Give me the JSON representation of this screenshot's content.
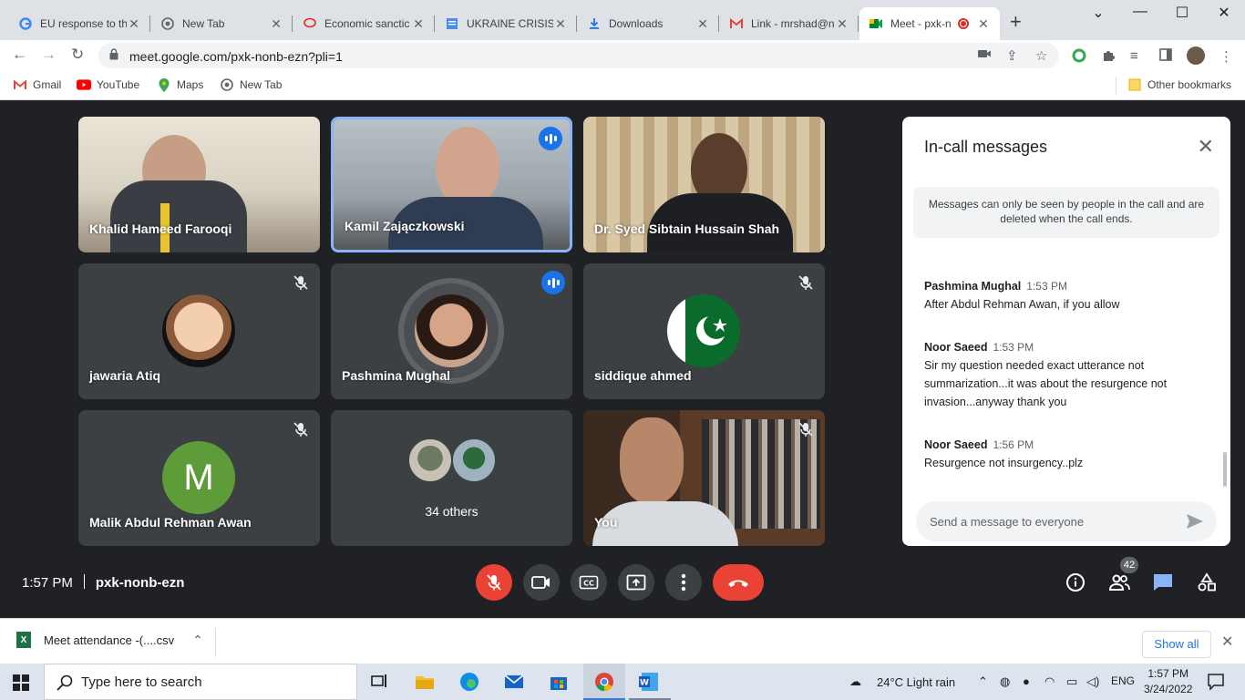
{
  "tabs": [
    {
      "title": "EU response to th",
      "icon": "google-icon"
    },
    {
      "title": "New Tab",
      "icon": "chrome-icon"
    },
    {
      "title": "Economic sanctic",
      "icon": "chat-bubble-icon"
    },
    {
      "title": "UKRAINE CRISIS",
      "icon": "doc-icon"
    },
    {
      "title": "Downloads",
      "icon": "download-icon"
    },
    {
      "title": "Link - mrshad@n",
      "icon": "gmail-icon"
    },
    {
      "title": "Meet - pxk-n",
      "icon": "meet-icon"
    }
  ],
  "address": {
    "url": "meet.google.com/pxk-nonb-ezn?pli=1"
  },
  "bookmarks": [
    {
      "label": "Gmail"
    },
    {
      "label": "YouTube"
    },
    {
      "label": "Maps"
    },
    {
      "label": "New Tab"
    }
  ],
  "other_bookmarks": "Other bookmarks",
  "participants": [
    {
      "name": "Khalid Hameed Farooqi"
    },
    {
      "name": "Kamil Zajączkowski"
    },
    {
      "name": "Dr. Syed Sibtain Hussain Shah"
    },
    {
      "name": "jawaria Atiq"
    },
    {
      "name": "Pashmina Mughal"
    },
    {
      "name": "siddique ahmed"
    },
    {
      "name": "Malik Abdul Rehman Awan",
      "initial": "M"
    },
    {
      "name": "34 others"
    },
    {
      "name": "You"
    }
  ],
  "chat": {
    "title": "In-call messages",
    "notice": "Messages can only be seen by people in the call and are deleted when the call ends.",
    "messages": [
      {
        "sender": "Pashmina Mughal",
        "time": "1:53 PM",
        "text": "After Abdul Rehman Awan, if you allow"
      },
      {
        "sender": "Noor Saeed",
        "time": "1:53 PM",
        "text": "Sir my question needed exact utterance not summarization...it was about the resurgence not invasion...anyway thank you"
      },
      {
        "sender": "Noor Saeed",
        "time": "1:56 PM",
        "text": "Resurgence not insurgency..plz"
      }
    ],
    "input_placeholder": "Send a message to everyone"
  },
  "controls": {
    "time": "1:57 PM",
    "meeting_code": "pxk-nonb-ezn",
    "people_count": "42"
  },
  "download": {
    "file": "Meet attendance -(....csv",
    "show_all": "Show all"
  },
  "taskbar": {
    "search_placeholder": "Type here to search",
    "weather": "24°C  Light rain",
    "lang": "ENG",
    "time": "1:57 PM",
    "date": "3/24/2022"
  },
  "colors": {
    "meet_bg": "#202124",
    "tile_bg": "#3c4043",
    "speaking_blue": "#1a73e8",
    "leave_red": "#ea4335",
    "chat_accent": "#1a73e8"
  }
}
